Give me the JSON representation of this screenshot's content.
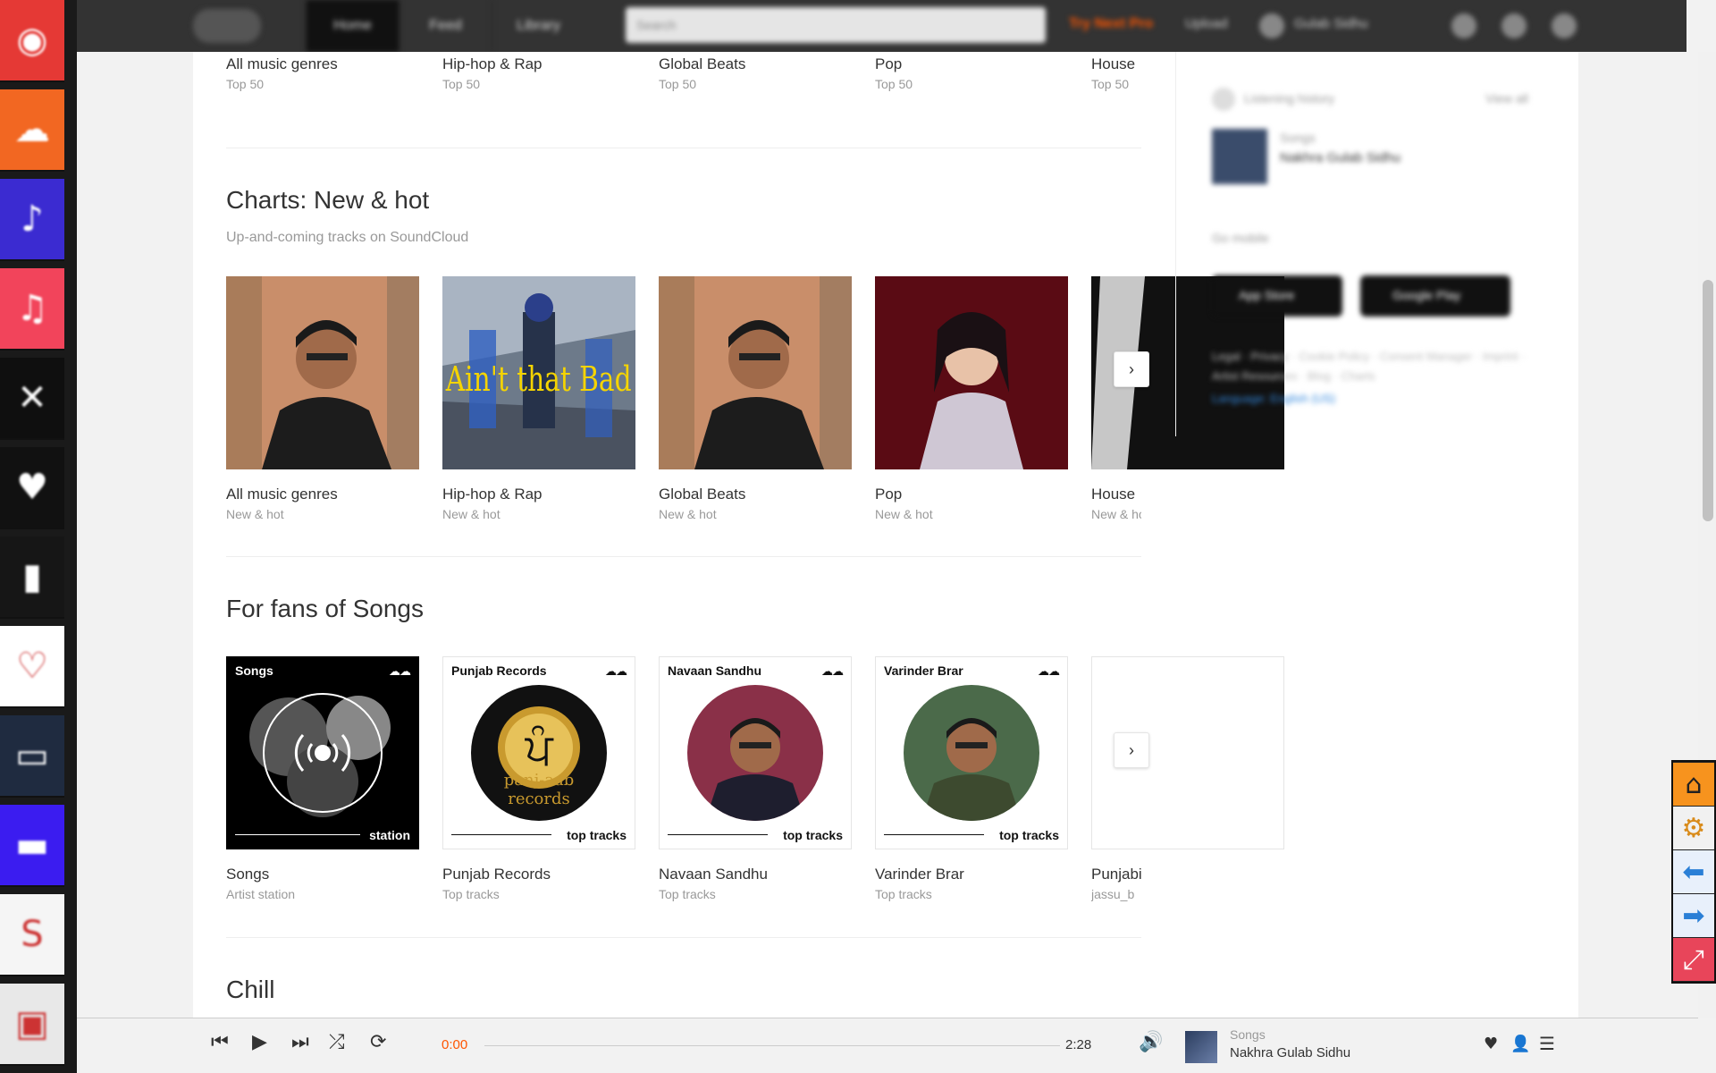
{
  "dock": {
    "apps": [
      {
        "icon": "youtube-music-icon",
        "color": "#e53935",
        "glyph": "◉"
      },
      {
        "icon": "soundcloud-icon",
        "color": "#f26722",
        "glyph": "☁"
      },
      {
        "icon": "amazon-music-icon",
        "color": "#3b2bd1",
        "glyph": "♪"
      },
      {
        "icon": "apple-music-icon",
        "color": "#f2445b",
        "glyph": "♫"
      },
      {
        "icon": "spotify-like-icon",
        "color": "#0f0f0f",
        "glyph": "✕"
      },
      {
        "icon": "deezer-icon",
        "color": "#111111",
        "glyph": "♥"
      },
      {
        "icon": "deezer-bars-icon",
        "color": "#161616",
        "glyph": "▮"
      },
      {
        "icon": "iheart-icon",
        "color": "#ffffff",
        "glyph": "♡"
      },
      {
        "icon": "tidal-icon",
        "color": "#1f2b40",
        "glyph": "▭"
      },
      {
        "icon": "gaana-icon",
        "color": "#3b1cf0",
        "glyph": "▬"
      },
      {
        "icon": "jiosaavn-icon",
        "color": "#f5f5f5",
        "glyph": "S"
      },
      {
        "icon": "radio-icon",
        "color": "#e8e8e8",
        "glyph": "▣"
      }
    ]
  },
  "header": {
    "tabs": [
      "Home",
      "Feed",
      "Library"
    ],
    "search_placeholder": "Search",
    "upgrade": "Try Next Pro",
    "upload": "Upload",
    "user": "Gulab Sidhu"
  },
  "top_row": {
    "cards": [
      {
        "title": "All music genres",
        "subtitle": "Top 50"
      },
      {
        "title": "Hip-hop & Rap",
        "subtitle": "Top 50"
      },
      {
        "title": "Global Beats",
        "subtitle": "Top 50"
      },
      {
        "title": "Pop",
        "subtitle": "Top 50"
      },
      {
        "title": "House",
        "subtitle": "Top 50"
      }
    ]
  },
  "charts": {
    "title": "Charts: New & hot",
    "subtitle": "Up-and-coming tracks on SoundCloud",
    "cards": [
      {
        "title": "All music genres",
        "subtitle": "New & hot"
      },
      {
        "title": "Hip-hop & Rap",
        "subtitle": "New & hot",
        "art_text": "Ain't that Bad"
      },
      {
        "title": "Global Beats",
        "subtitle": "New & hot"
      },
      {
        "title": "Pop",
        "subtitle": "New & hot"
      },
      {
        "title": "House",
        "subtitle": "New & hot"
      }
    ]
  },
  "fans": {
    "title": "For fans of Songs",
    "cards": [
      {
        "title": "Songs",
        "subtitle": "Artist station",
        "art_label": "Songs",
        "art_foot": "station"
      },
      {
        "title": "Punjab Records",
        "subtitle": "Top tracks",
        "art_label": "Punjab Records",
        "art_foot": "top tracks",
        "logo_text": "panj-aab records"
      },
      {
        "title": "Navaan Sandhu",
        "subtitle": "Top tracks",
        "art_label": "Navaan Sandhu",
        "art_foot": "top tracks"
      },
      {
        "title": "Varinder Brar",
        "subtitle": "Top tracks",
        "art_label": "Varinder Brar",
        "art_foot": "top tracks"
      },
      {
        "title": "Punjabi",
        "subtitle": "jassu_b"
      }
    ]
  },
  "chill": {
    "title": "Chill"
  },
  "sidebar": {
    "listening_history": "Listening history",
    "view_all": "View all",
    "history_artist": "Songs",
    "history_title": "Nakhra Gulab Sidhu",
    "go_mobile": "Go mobile",
    "app_store": "App Store",
    "google_play": "Google Play",
    "footer_links": "Legal · Privacy · Cookie Policy · Consent Manager · Imprint · Artist Resources · Blog · Charts",
    "language": "Language: English (US)"
  },
  "player": {
    "current_time": "0:00",
    "duration": "2:28",
    "progress_fraction": 0,
    "artist": "Songs",
    "title": "Nakhra Gulab Sidhu"
  },
  "colors": {
    "accent": "#ff5500",
    "header_bg": "#333333"
  }
}
